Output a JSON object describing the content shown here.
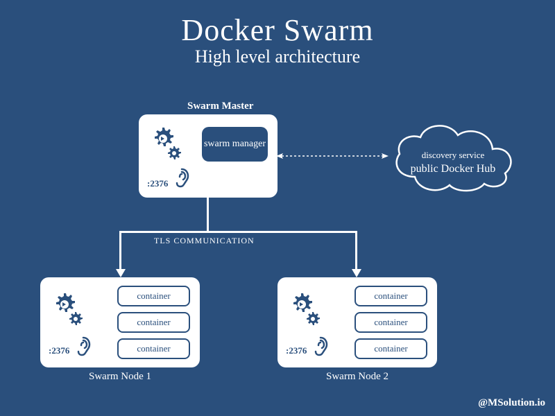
{
  "title": "Docker Swarm",
  "subtitle": "High level architecture",
  "master": {
    "label": "Swarm Master",
    "manager": "swarm manager",
    "port": ":2376"
  },
  "cloud": {
    "line1": "discovery service",
    "line2": "public Docker Hub"
  },
  "tls": "TLS COMMUNICATION",
  "nodes": {
    "container": "container",
    "port": ":2376",
    "node1_label": "Swarm Node 1",
    "node2_label": "Swarm Node 2"
  },
  "credit": "@MSolution.io",
  "colors": {
    "bg": "#2a4f7c",
    "fg": "#ffffff"
  }
}
